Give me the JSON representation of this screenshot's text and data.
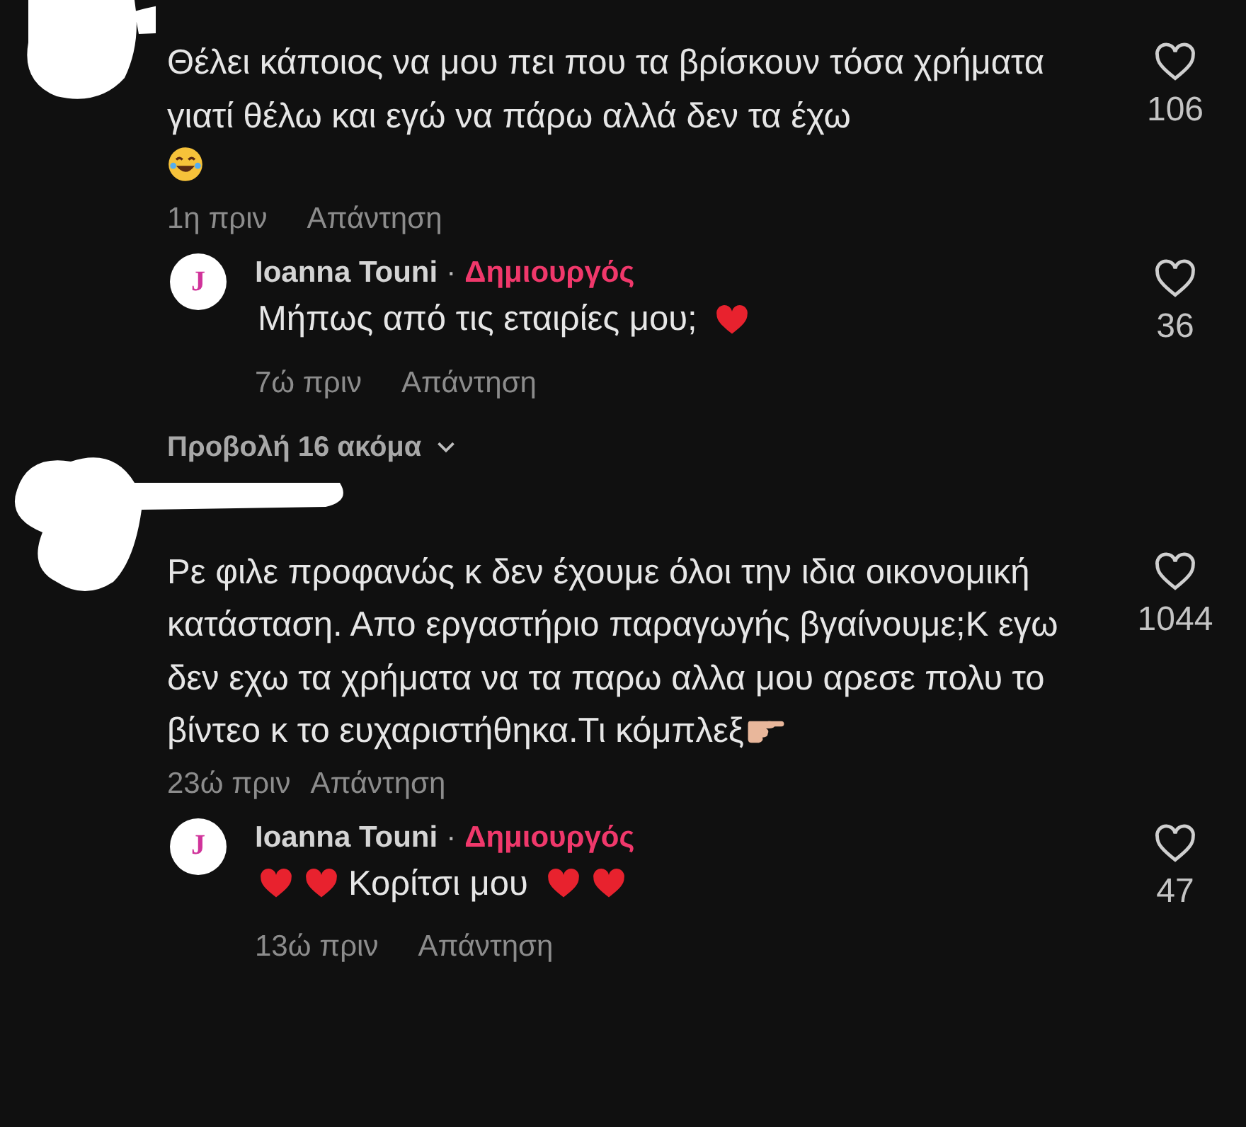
{
  "threads": [
    {
      "comment": {
        "text": "Θέλει κάποιος να μου πει που τα βρίσκουν τόσα χρήματα γιατί θέλω και εγώ να πάρω αλλά δεν τα έχω",
        "time": "1η πριν",
        "reply_label": "Απάντηση",
        "likes": "106"
      },
      "replies": [
        {
          "avatar_letter": "J",
          "author": "Ioanna Touni",
          "separator": "·",
          "badge": "Δημιουργός",
          "text": "Μήπως από τις εταιρίες μου;",
          "time": "7ώ πριν",
          "reply_label": "Απάντηση",
          "likes": "36"
        }
      ],
      "more": "Προβολή 16 ακόμα"
    },
    {
      "comment": {
        "text": "Ρε φιλε προφανώς κ δεν έχουμε όλοι την ιδια οικονομική κατάσταση. Απο εργαστήριο παραγωγής βγαίνουμε;Κ εγω δεν εχω τα χρήματα να τα παρω αλλα μου αρεσε πολυ το βίντεο κ το ευχαριστήθηκα.Τι κόμπλεξ",
        "time": "23ώ πριν",
        "reply_label": "Απάντηση",
        "likes": "1044"
      },
      "replies": [
        {
          "avatar_letter": "J",
          "author": "Ioanna Touni",
          "separator": "·",
          "badge": "Δημιουργός",
          "text": "Κορίτσι μου",
          "time": "13ώ πριν",
          "reply_label": "Απάντηση",
          "likes": "47"
        }
      ]
    }
  ]
}
